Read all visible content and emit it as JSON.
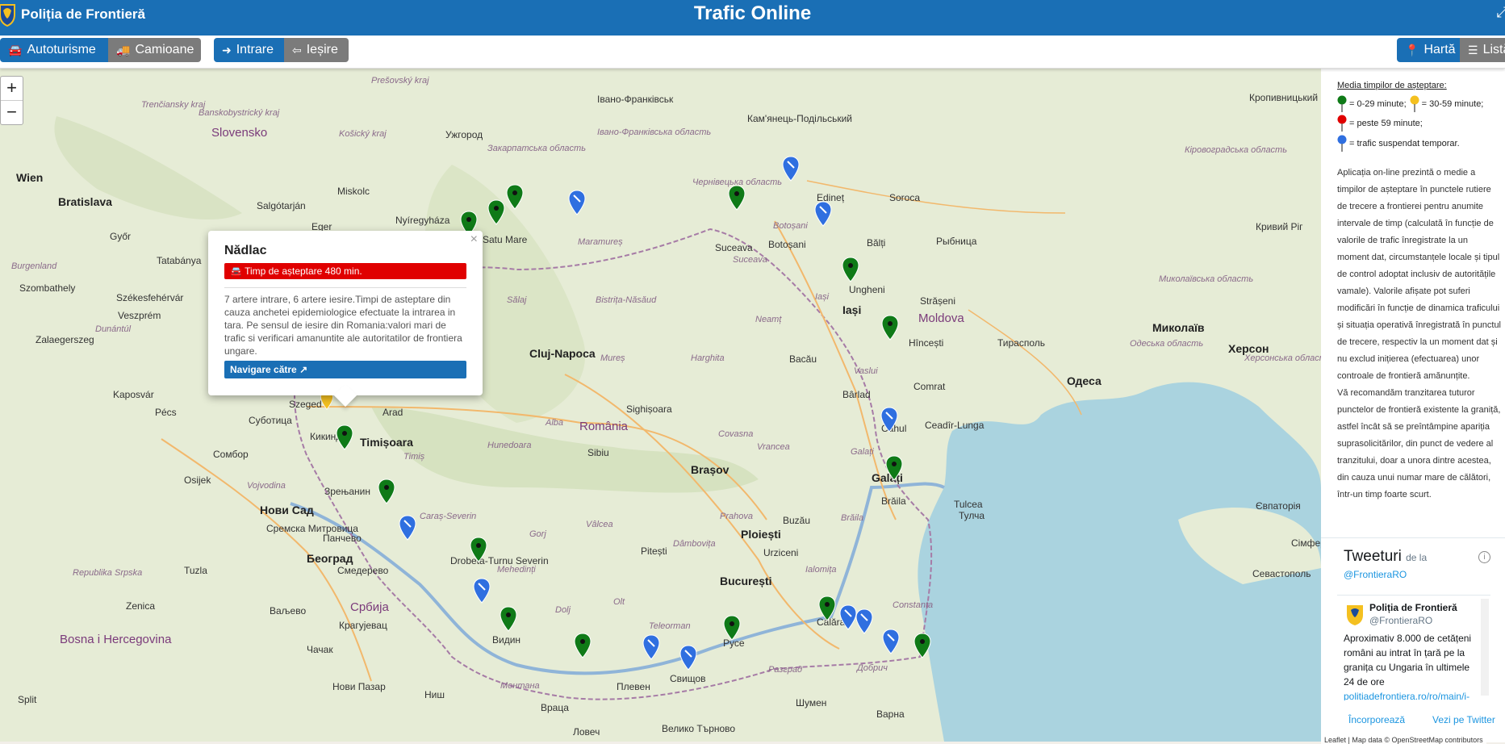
{
  "header": {
    "brand": "Poliția de Frontieră",
    "title": "Trafic Online",
    "expand_icon": "⤢"
  },
  "toolbar": {
    "autoturisme": "Autoturisme",
    "camioane": "Camioane",
    "intrare": "Intrare",
    "iesire": "Ieșire",
    "harta": "Hartă",
    "lista": "Listă"
  },
  "zoom": {
    "in": "+",
    "out": "−"
  },
  "map": {
    "places": [
      {
        "t": "Wien",
        "cls": "big"
      },
      {
        "t": "Bratislava",
        "cls": "big"
      },
      {
        "t": "Slovensko",
        "cls": "country"
      },
      {
        "t": "Trenčiansky kraj",
        "cls": "region"
      },
      {
        "t": "Banskobystrický kraj",
        "cls": "region"
      },
      {
        "t": "Košický kraj",
        "cls": "region"
      },
      {
        "t": "Prešovský kraj",
        "cls": "region"
      },
      {
        "t": "Miskolc",
        "cls": ""
      },
      {
        "t": "Ужгород",
        "cls": ""
      },
      {
        "t": "Eger",
        "cls": ""
      },
      {
        "t": "Nyíregyháza",
        "cls": ""
      },
      {
        "t": "Satu Mare",
        "cls": ""
      },
      {
        "t": "Salgótarján",
        "cls": ""
      },
      {
        "t": "Győr",
        "cls": ""
      },
      {
        "t": "Tatabánya",
        "cls": ""
      },
      {
        "t": "Szombathely",
        "cls": ""
      },
      {
        "t": "Székesfehérvár",
        "cls": ""
      },
      {
        "t": "Veszprém",
        "cls": ""
      },
      {
        "t": "Zalaegerszeg",
        "cls": ""
      },
      {
        "t": "Kaposvár",
        "cls": ""
      },
      {
        "t": "Pécs",
        "cls": ""
      },
      {
        "t": "Szeged",
        "cls": ""
      },
      {
        "t": "Суботица",
        "cls": ""
      },
      {
        "t": "Arad",
        "cls": ""
      },
      {
        "t": "Timișoara",
        "cls": "big"
      },
      {
        "t": "Кикинда",
        "cls": ""
      },
      {
        "t": "Сомбор",
        "cls": ""
      },
      {
        "t": "Osijek",
        "cls": ""
      },
      {
        "t": "Нови Сад",
        "cls": "big"
      },
      {
        "t": "Зрењанин",
        "cls": ""
      },
      {
        "t": "Сремска Митровица",
        "cls": ""
      },
      {
        "t": "Панчево",
        "cls": ""
      },
      {
        "t": "Београд",
        "cls": "big"
      },
      {
        "t": "Смедерево",
        "cls": ""
      },
      {
        "t": "Србија",
        "cls": "country"
      },
      {
        "t": "Крагујевац",
        "cls": ""
      },
      {
        "t": "Bosna i Hercegovina",
        "cls": "country"
      },
      {
        "t": "Republika Srpska",
        "cls": "region"
      },
      {
        "t": "Tuzla",
        "cls": ""
      },
      {
        "t": "Zenica",
        "cls": ""
      },
      {
        "t": "Ваљево",
        "cls": ""
      },
      {
        "t": "Чачак",
        "cls": ""
      },
      {
        "t": "Нови Пазар",
        "cls": ""
      },
      {
        "t": "Ниш",
        "cls": ""
      },
      {
        "t": "Split",
        "cls": ""
      },
      {
        "t": "Cluj-Napoca",
        "cls": "big"
      },
      {
        "t": "Sălaj",
        "cls": "region"
      },
      {
        "t": "Bistrița-Năsăud",
        "cls": "region"
      },
      {
        "t": "Maramureș",
        "cls": "region"
      },
      {
        "t": "Закарпатська область",
        "cls": "region"
      },
      {
        "t": "Івано-Франківськ",
        "cls": ""
      },
      {
        "t": "Івано-Франківська область",
        "cls": "region"
      },
      {
        "t": "Чернівецька область",
        "cls": "region"
      },
      {
        "t": "Кам'янець-Подільський",
        "cls": ""
      },
      {
        "t": "Suceava",
        "cls": ""
      },
      {
        "t": "Botoșani",
        "cls": ""
      },
      {
        "t": "Edineț",
        "cls": ""
      },
      {
        "t": "Soroca",
        "cls": ""
      },
      {
        "t": "Bălți",
        "cls": ""
      },
      {
        "t": "Ungheni",
        "cls": ""
      },
      {
        "t": "Iași",
        "cls": "big"
      },
      {
        "t": "Moldova",
        "cls": "country"
      },
      {
        "t": "Strășeni",
        "cls": ""
      },
      {
        "t": "Hîncești",
        "cls": ""
      },
      {
        "t": "Тирасполь",
        "cls": ""
      },
      {
        "t": "Comrat",
        "cls": ""
      },
      {
        "t": "Ceadîr-Lunga",
        "cls": ""
      },
      {
        "t": "Cahul",
        "cls": ""
      },
      {
        "t": "Galați",
        "cls": "big"
      },
      {
        "t": "Brăila",
        "cls": ""
      },
      {
        "t": "Tulcea",
        "cls": ""
      },
      {
        "t": "Bacău",
        "cls": ""
      },
      {
        "t": "Neamț",
        "cls": "region"
      },
      {
        "t": "Vaslui",
        "cls": "region"
      },
      {
        "t": "Bârlad",
        "cls": ""
      },
      {
        "t": "Mureș",
        "cls": "region"
      },
      {
        "t": "Harghita",
        "cls": "region"
      },
      {
        "t": "Alba",
        "cls": "region"
      },
      {
        "t": "Sighișoara",
        "cls": ""
      },
      {
        "t": "România",
        "cls": "country"
      },
      {
        "t": "Hunedoara",
        "cls": "region"
      },
      {
        "t": "Sibiu",
        "cls": ""
      },
      {
        "t": "Brașov",
        "cls": "big"
      },
      {
        "t": "Covasna",
        "cls": "region"
      },
      {
        "t": "Vrancea",
        "cls": "region"
      },
      {
        "t": "Buzău",
        "cls": ""
      },
      {
        "t": "Ploiești",
        "cls": "big"
      },
      {
        "t": "Prahova",
        "cls": "region"
      },
      {
        "t": "Dâmbovița",
        "cls": "region"
      },
      {
        "t": "Pitești",
        "cls": ""
      },
      {
        "t": "Vâlcea",
        "cls": "region"
      },
      {
        "t": "Gorj",
        "cls": "region"
      },
      {
        "t": "Caraș-Severin",
        "cls": "region"
      },
      {
        "t": "Mehedinți",
        "cls": "region"
      },
      {
        "t": "Drobeta-Turnu Severin",
        "cls": ""
      },
      {
        "t": "Dolj",
        "cls": "region"
      },
      {
        "t": "Olt",
        "cls": "region"
      },
      {
        "t": "Teleorman",
        "cls": "region"
      },
      {
        "t": "București",
        "cls": "big"
      },
      {
        "t": "Urziceni",
        "cls": ""
      },
      {
        "t": "Ialomița",
        "cls": "region"
      },
      {
        "t": "Călărași",
        "cls": ""
      },
      {
        "t": "Constanța",
        "cls": "region"
      },
      {
        "t": "Видин",
        "cls": ""
      },
      {
        "t": "Русе",
        "cls": ""
      },
      {
        "t": "Свищов",
        "cls": ""
      },
      {
        "t": "Плевен",
        "cls": ""
      },
      {
        "t": "Монтана",
        "cls": "region"
      },
      {
        "t": "Враца",
        "cls": ""
      },
      {
        "t": "Разград",
        "cls": "region"
      },
      {
        "t": "Добрич",
        "cls": "region"
      },
      {
        "t": "Шумен",
        "cls": ""
      },
      {
        "t": "Варна",
        "cls": ""
      },
      {
        "t": "Ловеч",
        "cls": ""
      },
      {
        "t": "Велико Търново",
        "cls": ""
      },
      {
        "t": "Одеса",
        "cls": "big"
      },
      {
        "t": "Миколаїв",
        "cls": "big"
      },
      {
        "t": "Херсон",
        "cls": "big"
      },
      {
        "t": "Миколаївська область",
        "cls": "region"
      },
      {
        "t": "Кропивницький",
        "cls": ""
      },
      {
        "t": "Кіровоградська область",
        "cls": "region"
      },
      {
        "t": "Кривий Ріг",
        "cls": ""
      },
      {
        "t": "Рыбница",
        "cls": ""
      },
      {
        "t": "Євпаторія",
        "cls": ""
      },
      {
        "t": "Севастополь",
        "cls": ""
      },
      {
        "t": "Сімферополь",
        "cls": ""
      },
      {
        "t": "Burgenland",
        "cls": "region"
      },
      {
        "t": "Dunántúl",
        "cls": "region"
      },
      {
        "t": "Vojvodina",
        "cls": "region"
      },
      {
        "t": "Galați",
        "cls": "region"
      },
      {
        "t": "Brăila",
        "cls": "region"
      },
      {
        "t": "Iași",
        "cls": "region"
      },
      {
        "t": "Botoșani",
        "cls": "region"
      },
      {
        "t": "Suceava",
        "cls": "region"
      },
      {
        "t": "Timiș",
        "cls": "region"
      },
      {
        "t": "Херсонська область",
        "cls": "region"
      },
      {
        "t": "Одеська область",
        "cls": "region"
      },
      {
        "t": "Тулча",
        "cls": ""
      }
    ],
    "markers": [
      {
        "color": "green"
      },
      {
        "color": "green"
      },
      {
        "color": "green"
      },
      {
        "color": "blue"
      },
      {
        "color": "blue"
      },
      {
        "color": "green"
      },
      {
        "color": "blue"
      },
      {
        "color": "green"
      },
      {
        "color": "green"
      },
      {
        "color": "blue"
      },
      {
        "color": "green"
      },
      {
        "color": "green"
      },
      {
        "color": "blue"
      },
      {
        "color": "green"
      },
      {
        "color": "blue"
      },
      {
        "color": "green"
      },
      {
        "color": "green"
      },
      {
        "color": "blue"
      },
      {
        "color": "blue"
      },
      {
        "color": "green"
      },
      {
        "color": "green"
      },
      {
        "color": "blue"
      },
      {
        "color": "blue"
      },
      {
        "color": "blue"
      },
      {
        "color": "green"
      },
      {
        "color": "yellow"
      }
    ]
  },
  "popup": {
    "close": "×",
    "title": "Nădlac",
    "wait": "Timp de așteptare 480 min.",
    "note": "7 artere intrare, 6 artere iesire.Timpi de asteptare din cauza anchetei epidemiologice efectuate la intrarea in tara. Pe sensul de iesire din Romania:valori mari de trafic si verificari amanuntite ale autoritatilor de frontiera ungare.",
    "nav": "Navigare către"
  },
  "sidebar": {
    "legend_title": "Media timpilor de așteptare:",
    "green_label": "= 0-29 minute;",
    "yellow_label": "= 30-59 minute;",
    "red_label": "= peste 59 minute;",
    "blue_label": "= trafic suspendat temporar.",
    "description_1": "Aplicația on-line prezintă o medie a timpilor de așteptare în punctele rutiere de trecere a frontierei pentru anumite intervale de timp (calculată în funcție de valorile de trafic înregistrate la un moment dat, circumstanțele locale și tipul de control adoptat inclusiv de autoritățile vamale). Valorile afișate pot suferi modificări în funcție de dinamica traficului și situația operativă înregistrată în punctul de trecere, respectiv la un moment dat și nu exclud inițierea (efectuarea) unor controale de frontieră amănunțite.",
    "description_2": "Vă recomandăm tranzitarea tuturor punctelor de frontieră existente la graniță, astfel încât să se preîntâmpine apariția suprasolicitărilor, din punct de vedere al tranzitului, doar a unora dintre acestea, din cauza unui numar mare de călători, într-un timp foarte scurt."
  },
  "twitter": {
    "title": "Tweeturi",
    "from": "de la",
    "handle": "@FrontieraRO",
    "info": "i",
    "author_name": "Poliția de Frontieră",
    "author_handle": "@FrontieraRO",
    "text": "Aproximativ 8.000 de cetățeni români au intrat în țară pe la granița cu Ungaria în ultimele 24 de ore",
    "link": "politiadefrontiera.ro/ro/main/i-",
    "embed": "Încorporează",
    "view": "Vezi pe Twitter"
  },
  "attribution": "Leaflet | Map data © OpenStreetMap contributors",
  "colors": {
    "header": "#1a6fb5",
    "green": "#0f7a17",
    "blue": "#2f6fe0",
    "red": "#e00000",
    "yellow": "#f4c020"
  }
}
